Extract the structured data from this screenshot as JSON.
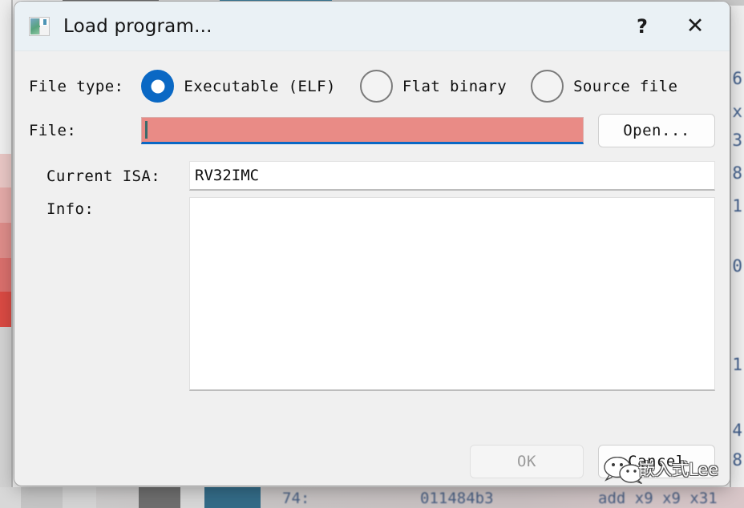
{
  "window": {
    "title": "Load program...",
    "icon": "program-window-icon",
    "help_glyph": "?",
    "close_glyph": "✕"
  },
  "form": {
    "file_type": {
      "label": "File type:",
      "options": [
        {
          "label": "Executable (ELF)",
          "selected": true
        },
        {
          "label": "Flat binary",
          "selected": false
        },
        {
          "label": "Source file",
          "selected": false
        }
      ]
    },
    "file": {
      "label": "File:",
      "value": "",
      "placeholder": "",
      "state": "invalid-focused",
      "error_color": "#e98b86",
      "focus_color": "#0a68c4"
    },
    "open_button": {
      "label": "Open..."
    },
    "current_isa": {
      "label": "Current ISA:",
      "value": "RV32IMC"
    },
    "info": {
      "label": "Info:",
      "value": ""
    }
  },
  "footer": {
    "ok_label": "OK",
    "ok_enabled": false,
    "cancel_label": "Cancel"
  },
  "watermark": {
    "text": "嵌入式Lee",
    "logo": "wechat-icon"
  },
  "background": {
    "right_numbers": [
      "6",
      "x",
      "3",
      "8",
      "1",
      "0",
      "1",
      "4",
      "8"
    ],
    "bottom_line": {
      "index": "74:",
      "opcode": "011484b3",
      "disasm": "add x9 x9 x31"
    },
    "heat_colors": [
      "#eeeeee",
      "#e8c6c4",
      "#e3a9a7",
      "#dd8c89",
      "#d96f6c",
      "#d94a43",
      "#d2d2d2"
    ]
  },
  "colors": {
    "accent": "#0a68c4",
    "dialog_bg": "#f0f0f0",
    "titlebar_bg": "#eaf1f5",
    "error": "#e98b86"
  }
}
